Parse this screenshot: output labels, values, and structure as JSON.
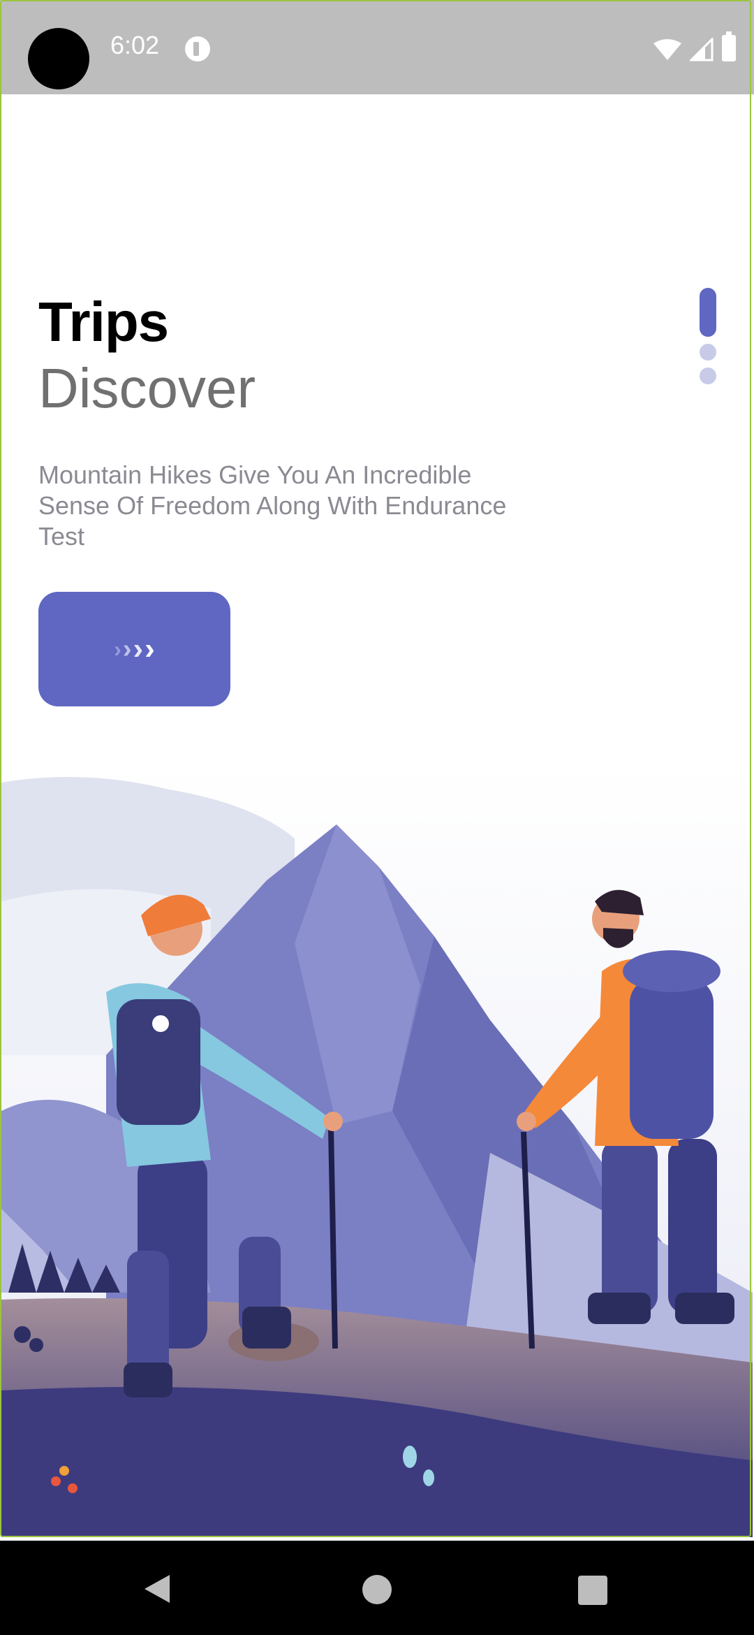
{
  "status_bar": {
    "time": "6:02",
    "icons": [
      "camera-cutout-icon",
      "app-notification-icon",
      "wifi-icon",
      "signal-icon",
      "battery-icon"
    ]
  },
  "onboarding": {
    "title": "Trips",
    "subtitle": "Discover",
    "description": "Mountain Hikes Give You An Incredible Sense Of Freedom Along With Endurance Test",
    "next_icon": "chevrons-right-icon",
    "page_count": 3,
    "active_page": 1
  },
  "colors": {
    "accent": "#5f67c3",
    "accent_light": "#c7cbe8",
    "title": "#000000",
    "subtitle": "#707070",
    "description": "#8a8a92",
    "status_bar": "#bdbdbd",
    "nav_bar": "#000000"
  },
  "illustration": {
    "subject": "hikers-mountain-illustration"
  },
  "nav_bar": {
    "icons": [
      "back-icon",
      "home-icon",
      "recents-icon"
    ]
  }
}
